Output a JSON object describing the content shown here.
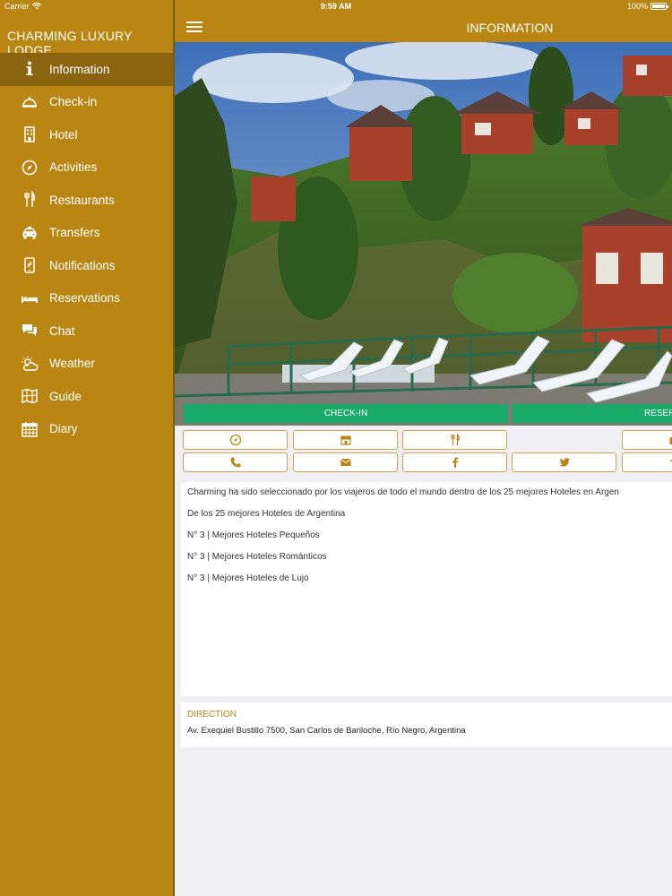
{
  "status_bar": {
    "carrier": "Carrier",
    "time": "9:59 AM",
    "battery": "100%",
    "battery_level": 1.0
  },
  "sidebar": {
    "title": "CHARMING LUXURY LODGE",
    "items": [
      {
        "label": "Information",
        "icon": "info-icon",
        "active": true
      },
      {
        "label": "Check-in",
        "icon": "bell-icon"
      },
      {
        "label": "Hotel",
        "icon": "building-icon"
      },
      {
        "label": "Activities",
        "icon": "compass-icon"
      },
      {
        "label": "Restaurants",
        "icon": "fork-knife-icon"
      },
      {
        "label": "Transfers",
        "icon": "taxi-icon"
      },
      {
        "label": "Notifications",
        "icon": "phone-notification-icon"
      },
      {
        "label": "Reservations",
        "icon": "bed-icon"
      },
      {
        "label": "Chat",
        "icon": "chat-icon"
      },
      {
        "label": "Weather",
        "icon": "weather-icon"
      },
      {
        "label": "Guide",
        "icon": "map-icon"
      },
      {
        "label": "Diary",
        "icon": "calendar-icon"
      }
    ]
  },
  "header": {
    "title": "INFORMATION"
  },
  "hero": {
    "checkin_label": "CHECK-IN",
    "reserve_label": "RESER"
  },
  "icon_rows": [
    [
      "compass-icon",
      "shop-icon",
      "fork-knife-icon",
      "",
      "suitcase-icon"
    ],
    [
      "phone-icon",
      "envelope-icon",
      "facebook-icon",
      "twitter-icon",
      "wifi-icon"
    ]
  ],
  "info": {
    "lines": [
      "Charming ha sido seleccionado por los viajeros de todo el mundo dentro de los 25 mejores Hoteles en Argen",
      "De los 25 mejores Hoteles de Argentina",
      "N° 3 | Mejores Hoteles Pequeños",
      "N° 3 | Mejores Hoteles Románticos",
      "N° 3 | Mejores Hoteles de Lujo"
    ]
  },
  "direction": {
    "label": "DIRECTION",
    "value": "Av. Exequiel Bustillo 7500, San Carlos de Bariloche, Río Negro, Argentina"
  },
  "colors": {
    "brand": "#b98614",
    "active": "#8b6410",
    "cta": "#1aab6a",
    "border": "#c9a253"
  }
}
